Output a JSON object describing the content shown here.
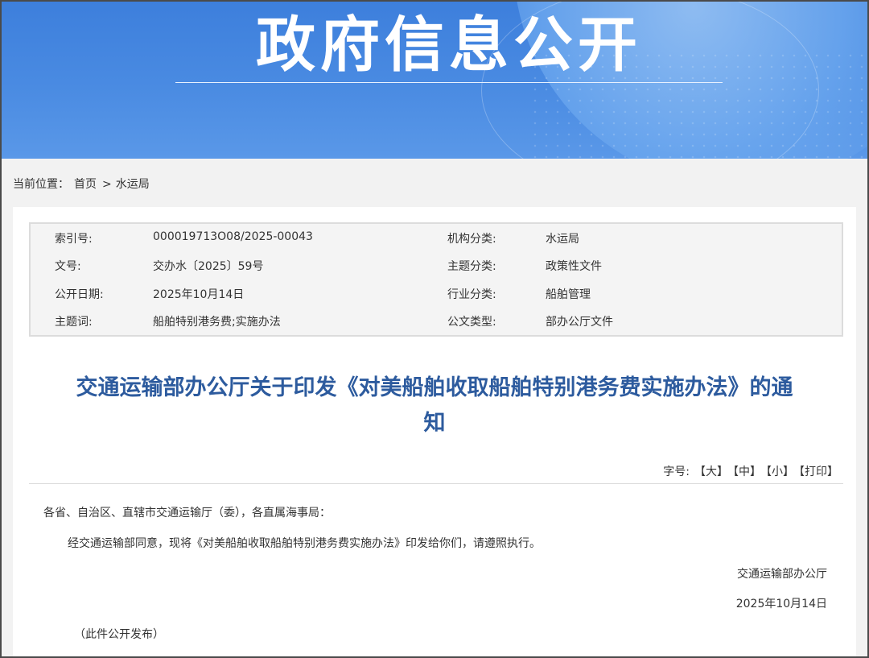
{
  "banner": {
    "title": "政府信息公开"
  },
  "breadcrumb": {
    "prefix": "当前位置：",
    "home": "首页",
    "separator": ">",
    "current": "水运局"
  },
  "meta": {
    "rows": [
      {
        "k1": "索引号:",
        "v1": "000019713O08/2025-00043",
        "k2": "机构分类:",
        "v2": "水运局"
      },
      {
        "k1": "文号:",
        "v1": "交办水〔2025〕59号",
        "k2": "主题分类:",
        "v2": "政策性文件"
      },
      {
        "k1": "公开日期:",
        "v1": "2025年10月14日",
        "k2": "行业分类:",
        "v2": "船舶管理"
      },
      {
        "k1": "主题词:",
        "v1": "船舶特别港务费;实施办法",
        "k2": "公文类型:",
        "v2": "部办公厅文件"
      }
    ]
  },
  "document": {
    "title_line1": "交通运输部办公厅关于印发《对美船舶收取船舶特别港务费实施办法》的通",
    "title_line2": "知",
    "salutation": "各省、自治区、直辖市交通运输厅（委），各直属海事局：",
    "paragraph": "经交通运输部同意，现将《对美船舶收取船舶特别港务费实施办法》印发给你们，请遵照执行。",
    "sign_org": "交通运输部办公厅",
    "sign_date": "2025年10月14日",
    "note": "（此件公开发布）"
  },
  "font_size_bar": {
    "label": "字号:",
    "large": "【大】",
    "medium": "【中】",
    "small": "【小】",
    "print": "【打印】"
  },
  "colors": {
    "banner": "#4a8be2",
    "title": "#2d5b9e",
    "page_bg": "#f2f2f2"
  }
}
